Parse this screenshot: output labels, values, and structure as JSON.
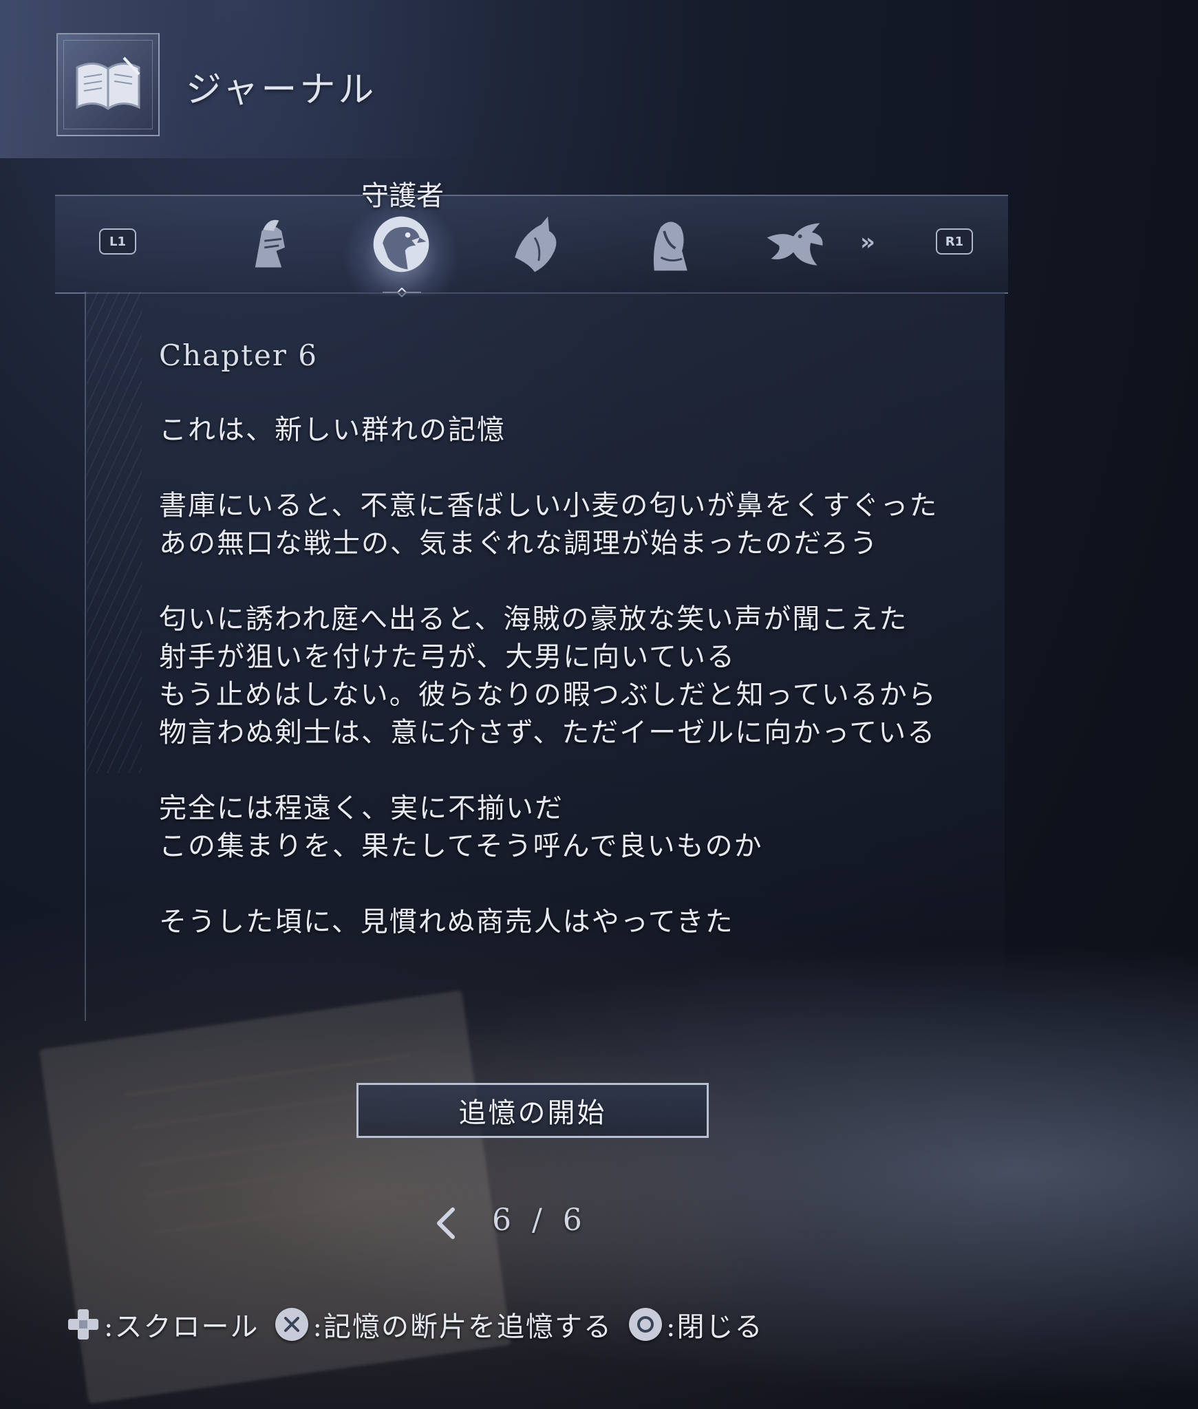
{
  "header": {
    "title": "ジャーナル",
    "icon": "open-book-icon"
  },
  "tabs": {
    "left_button": "L1",
    "right_button": "R1",
    "active_label": "守護者",
    "items": [
      {
        "icon": "knight-helmet-icon",
        "active": false
      },
      {
        "icon": "griffin-icon",
        "active": true
      },
      {
        "icon": "winged-hood-icon",
        "active": false
      },
      {
        "icon": "hooded-figure-icon",
        "active": false
      },
      {
        "icon": "dragon-emblem-icon",
        "active": false
      }
    ],
    "more_icon": "double-chevron-right-icon"
  },
  "content": {
    "chapter": "Chapter 6",
    "paragraphs": [
      [
        "これは、新しい群れの記憶"
      ],
      [
        "書庫にいると、不意に香ばしい小麦の匂いが鼻をくすぐった",
        "あの無口な戦士の、気まぐれな調理が始まったのだろう"
      ],
      [
        "匂いに誘われ庭へ出ると、海賊の豪放な笑い声が聞こえた",
        "射手が狙いを付けた弓が、大男に向いている",
        "もう止めはしない。彼らなりの暇つぶしだと知っているから",
        "物言わぬ剣士は、意に介さず、ただイーゼルに向かっている"
      ],
      [
        "完全には程遠く、実に不揃いだ",
        "この集まりを、果たしてそう呼んで良いものか"
      ],
      [
        "そうした頃に、見慣れぬ商売人はやってきた"
      ]
    ]
  },
  "action_button": "追憶の開始",
  "pager": {
    "current": 6,
    "total": 6,
    "text": "6 / 6"
  },
  "footer": {
    "hints": [
      {
        "icon": "dpad-icon",
        "label": ":スクロール"
      },
      {
        "icon": "cross-button-icon",
        "label": ":記憶の断片を追憶する"
      },
      {
        "icon": "circle-button-icon",
        "label": ":閉じる"
      }
    ]
  },
  "colors": {
    "background": "#121826",
    "text": "#e7eaf1",
    "accent": "#b8c1d4"
  }
}
